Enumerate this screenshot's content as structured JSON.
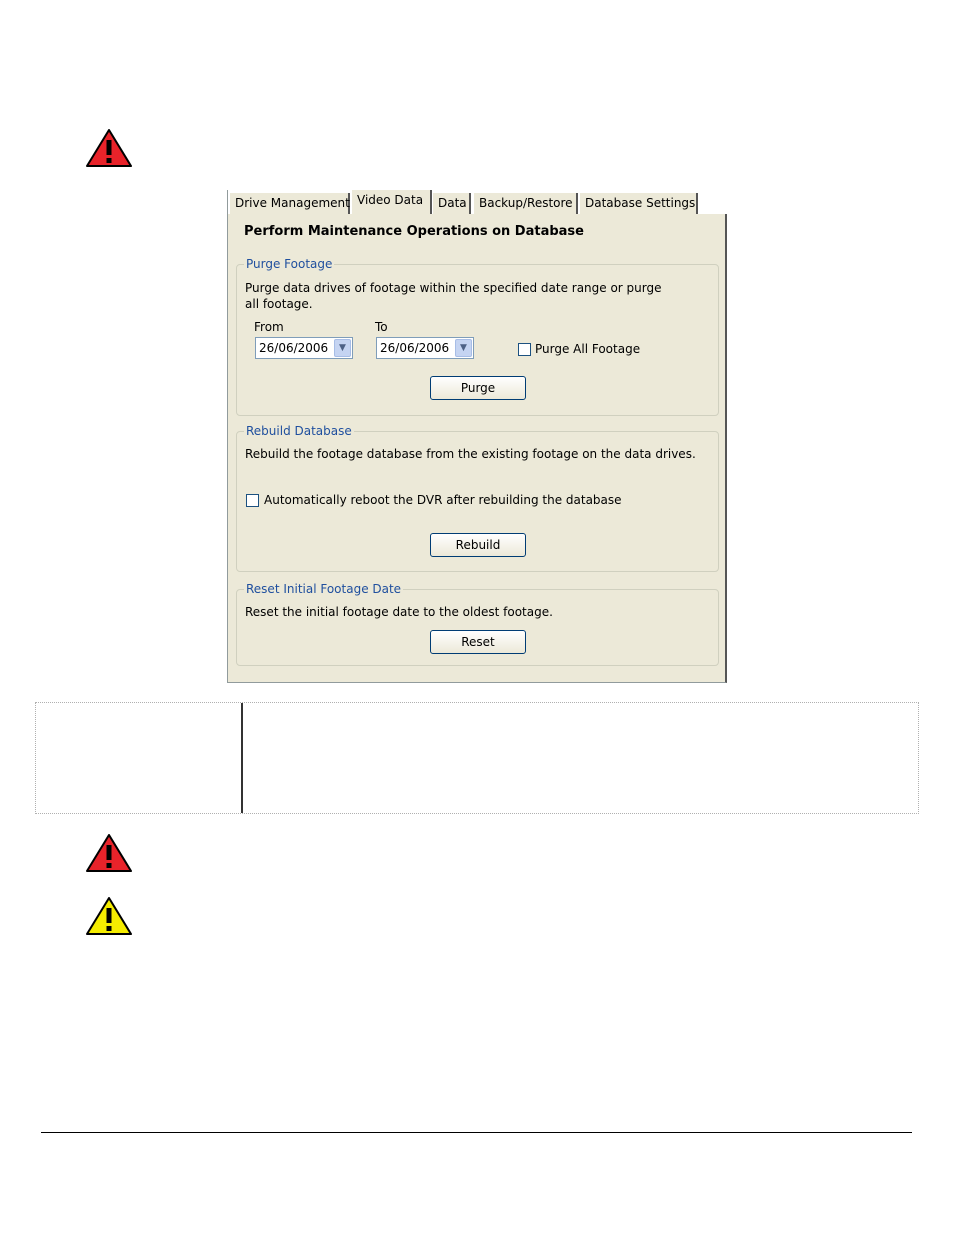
{
  "dialog": {
    "tabs": [
      "Drive Management",
      "Video Data",
      "Data",
      "Backup/Restore",
      "Database Settings"
    ],
    "active_tab": "Video Data",
    "title": "Perform Maintenance Operations on Database",
    "purge": {
      "legend": "Purge Footage",
      "description": "Purge data drives of footage within the specified date range or purge all footage.",
      "from_label": "From",
      "to_label": "To",
      "from_value": "26/06/2006",
      "to_value": "26/06/2006",
      "purge_all_label": "Purge All Footage",
      "button": "Purge"
    },
    "rebuild": {
      "legend": "Rebuild Database",
      "description": "Rebuild the footage database from the existing footage on the data drives.",
      "reboot_label": "Automatically reboot the DVR after rebuilding the database",
      "button": "Rebuild"
    },
    "reset": {
      "legend": "Reset Initial Footage Date",
      "description": "Reset the initial footage date to the oldest footage.",
      "button": "Reset"
    }
  },
  "colors": {
    "warning_red": "#e8232a",
    "caution_yellow": "#f5ec00",
    "dialog_bg": "#ece9d8",
    "legend_blue": "#1f4f9e"
  }
}
